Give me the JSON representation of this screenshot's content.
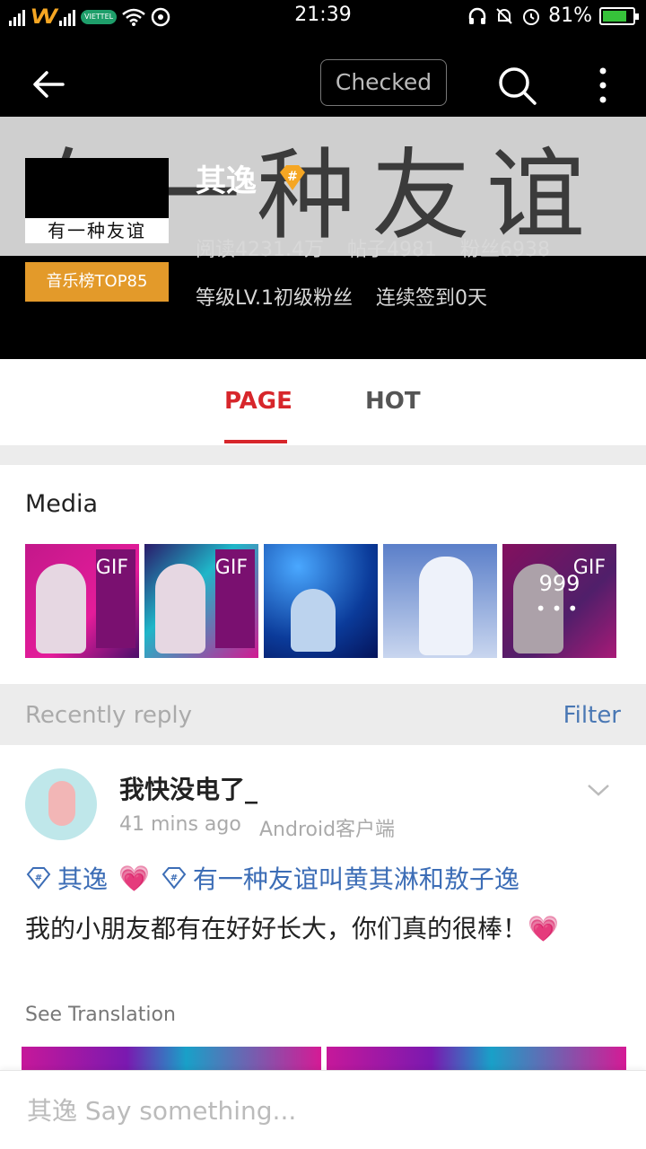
{
  "status_bar": {
    "time": "21:39",
    "battery": "81%",
    "battery_level": 0.81,
    "carrier_badge": "VIETTEL"
  },
  "header": {
    "checked_label": "Checked",
    "banner_text": "有一种友谊",
    "avatar_label": "有一种友谊",
    "rank_badge": "音乐榜TOP85",
    "group_name": "其逸",
    "reads": "阅读4231.4万",
    "posts": "帖子4981",
    "fans": "粉丝6938",
    "level": "等级LV.1初级粉丝",
    "checkin": "连续签到0天",
    "vip_color": "#f5a623"
  },
  "tabs": [
    {
      "label": "PAGE",
      "active": true
    },
    {
      "label": "HOT",
      "active": false
    }
  ],
  "media": {
    "title": "Media",
    "thumbs": [
      {
        "badge": "GIF"
      },
      {
        "badge": "GIF"
      },
      {
        "badge": ""
      },
      {
        "badge": ""
      },
      {
        "badge": "GIF",
        "count": "999",
        "dots": "•••"
      }
    ]
  },
  "filter_bar": {
    "recently_label": "Recently reply",
    "filter_label": "Filter"
  },
  "post": {
    "username": "我快没电了_",
    "time_ago": "41  mins ago",
    "client": "Android客户端",
    "tag1": "其逸",
    "tag2": "有一种友谊叫黄其淋和敖子逸",
    "heart": "💗",
    "body": "我的小朋友都有在好好长大，你们真的很棒！💗",
    "see_translation": "See Translation"
  },
  "comment": {
    "placeholder": "其逸 Say something..."
  },
  "colors": {
    "accent_red": "#d7262b",
    "link_blue": "#4a78b4",
    "rank_orange": "#e39a2a"
  }
}
